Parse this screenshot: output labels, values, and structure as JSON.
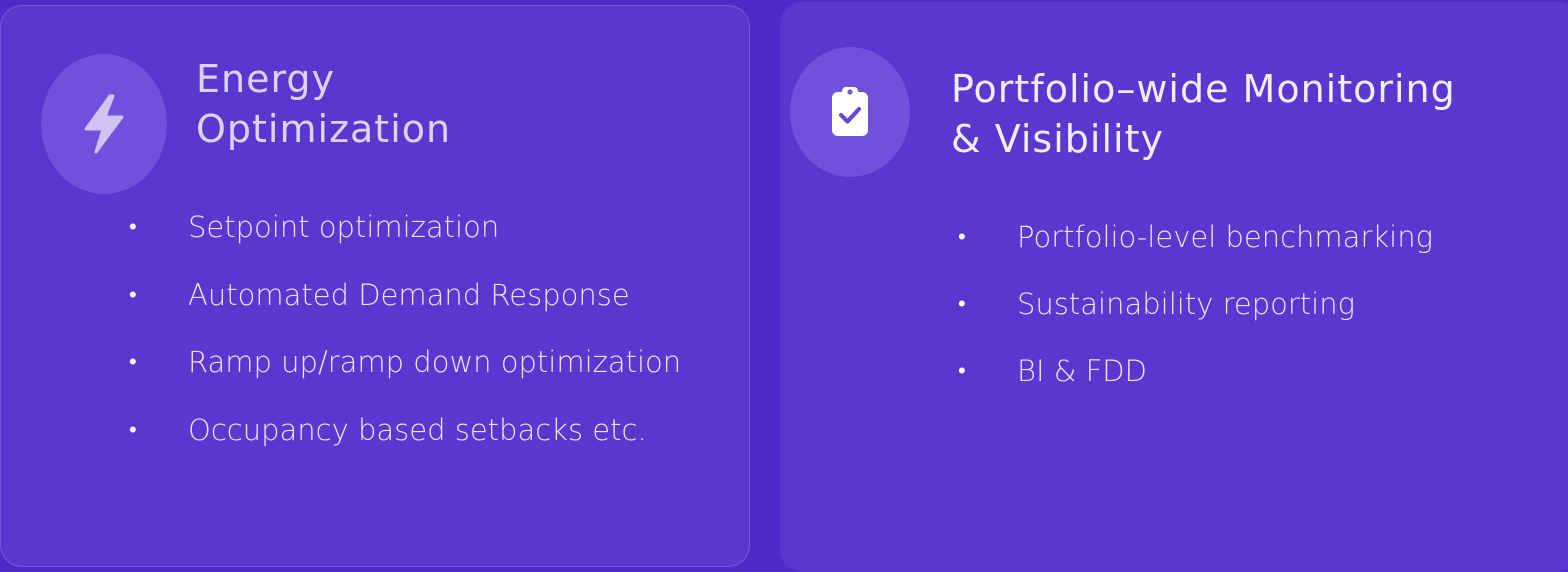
{
  "cards": [
    {
      "icon": "lightning-bolt-icon",
      "title_line1": "Energy",
      "title_line2": "Optimization",
      "bullets": [
        "Setpoint optimization",
        "Automated Demand Response",
        "Ramp up/ramp down optimization",
        "Occupancy based setbacks etc."
      ]
    },
    {
      "icon": "clipboard-check-icon",
      "title_line1": "Portfolio–wide Monitoring",
      "title_line2": "& Visibility",
      "bullets": [
        "Portfolio-level benchmarking",
        "Sustainability reporting",
        "BI & FDD"
      ]
    }
  ],
  "colors": {
    "background": "#4e2ac9",
    "card": "#5a37cf",
    "icon_circle": "#7a58e0",
    "text": "#ece6ff"
  }
}
